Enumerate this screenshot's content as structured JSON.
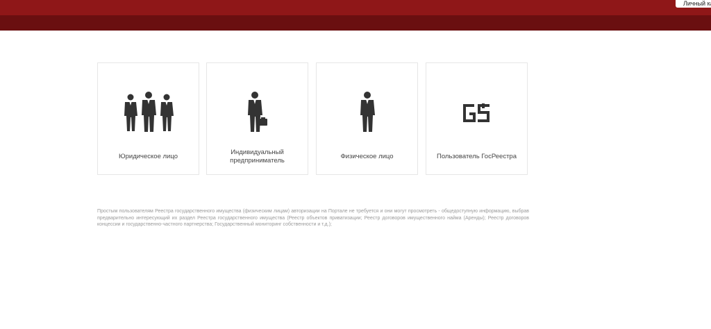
{
  "header": {
    "account_label": "Личный кабинет"
  },
  "cards": [
    {
      "label": "Юридическое лицо",
      "icon": "group-of-people-icon"
    },
    {
      "label": "Индивидуальный предприниматель",
      "icon": "businessman-with-briefcase-icon"
    },
    {
      "label": "Физическое лицо",
      "icon": "person-icon"
    },
    {
      "label": "Пользователь ГосРеестра",
      "icon": "gosreestr-logo-icon"
    }
  ],
  "info_text": "Простым пользователям Реестра государственного имущества (физическим лицам) авторизации на Портале не требуется и они могут просмотреть - общедоступную информацию, выбрав предварительно интересующий их раздел Реестра государственного имущества (Реестр объектов приватизации; Реестр договоров имущественного найма (Аренды); Реестр договоров концессии и государственно-частного партнерства; Государственный мониторинг собственности и т.д.);",
  "colors": {
    "header_top": "#8f1718",
    "header_bottom": "#6a0f10",
    "icon": "#333333"
  }
}
